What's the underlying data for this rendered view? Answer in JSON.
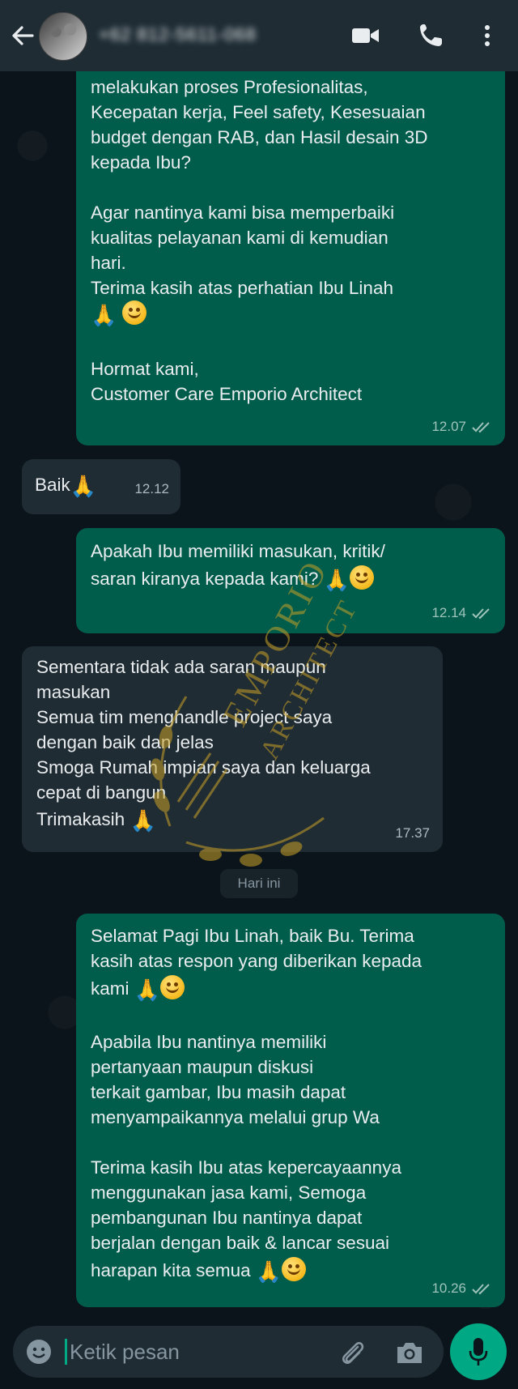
{
  "header": {
    "contact": "+62 812-5611-068"
  },
  "messages": [
    {
      "dir": "out",
      "lines": [
        "melakukan proses Profesionalitas,",
        "Kecepatan kerja, Feel safety, Kesesuaian",
        "budget dengan RAB, dan Hasil desain 3D",
        "kepada Ibu?",
        "",
        "Agar nantinya kami bisa memperbaiki",
        "kualitas pelayanan kami di kemudian",
        "hari.",
        "Terima kasih atas perhatian Ibu Linah",
        "",
        "",
        "Hormat kami,",
        "Customer Care Emporio Architect"
      ],
      "time": "12.07"
    },
    {
      "dir": "in",
      "text": "Baik",
      "time": "12.12"
    },
    {
      "dir": "out",
      "lines": [
        "Apakah Ibu memiliki masukan, kritik/",
        "saran kiranya kepada kami?"
      ],
      "time": "12.14"
    },
    {
      "dir": "in",
      "lines": [
        "Sementara tidak ada saran maupun",
        "masukan",
        "Semua tim menghandle project saya",
        "dengan baik dan jelas",
        "Smoga Rumah impian saya dan keluarga",
        "cepat di bangun",
        "Trimakasih"
      ],
      "time": "17.37"
    },
    {
      "dir": "out",
      "lines": [
        "Selamat Pagi Ibu Linah, baik Bu. Terima",
        "kasih atas respon yang diberikan kepada",
        "kami",
        "",
        "Apabila Ibu nantinya memiliki",
        "pertanyaan maupun diskusi",
        "terkait gambar, Ibu masih dapat",
        "menyampaikannya melalui grup Wa",
        "",
        "Terima kasih Ibu atas kepercayaannya",
        "menggunakan jasa kami, Semoga",
        "pembangunan Ibu nantinya dapat",
        "berjalan dengan baik & lancar sesuai",
        "harapan kita semua"
      ],
      "time": "10.26"
    }
  ],
  "date_divider": "Hari ini",
  "watermark": {
    "line1": "EMPORIO",
    "line2": "ARCHITECT"
  },
  "input": {
    "placeholder": "Ketik pesan"
  },
  "colors": {
    "outgoing": "#005c4b",
    "incoming": "#202c33",
    "accent": "#00a884",
    "header": "#1f2c34"
  },
  "icons": [
    "back-arrow-icon",
    "video-call-icon",
    "phone-icon",
    "more-options-icon",
    "emoji-icon",
    "attach-icon",
    "camera-icon",
    "mic-icon",
    "double-check-icon",
    "folded-hands-emoji",
    "smiling-face-emoji"
  ]
}
